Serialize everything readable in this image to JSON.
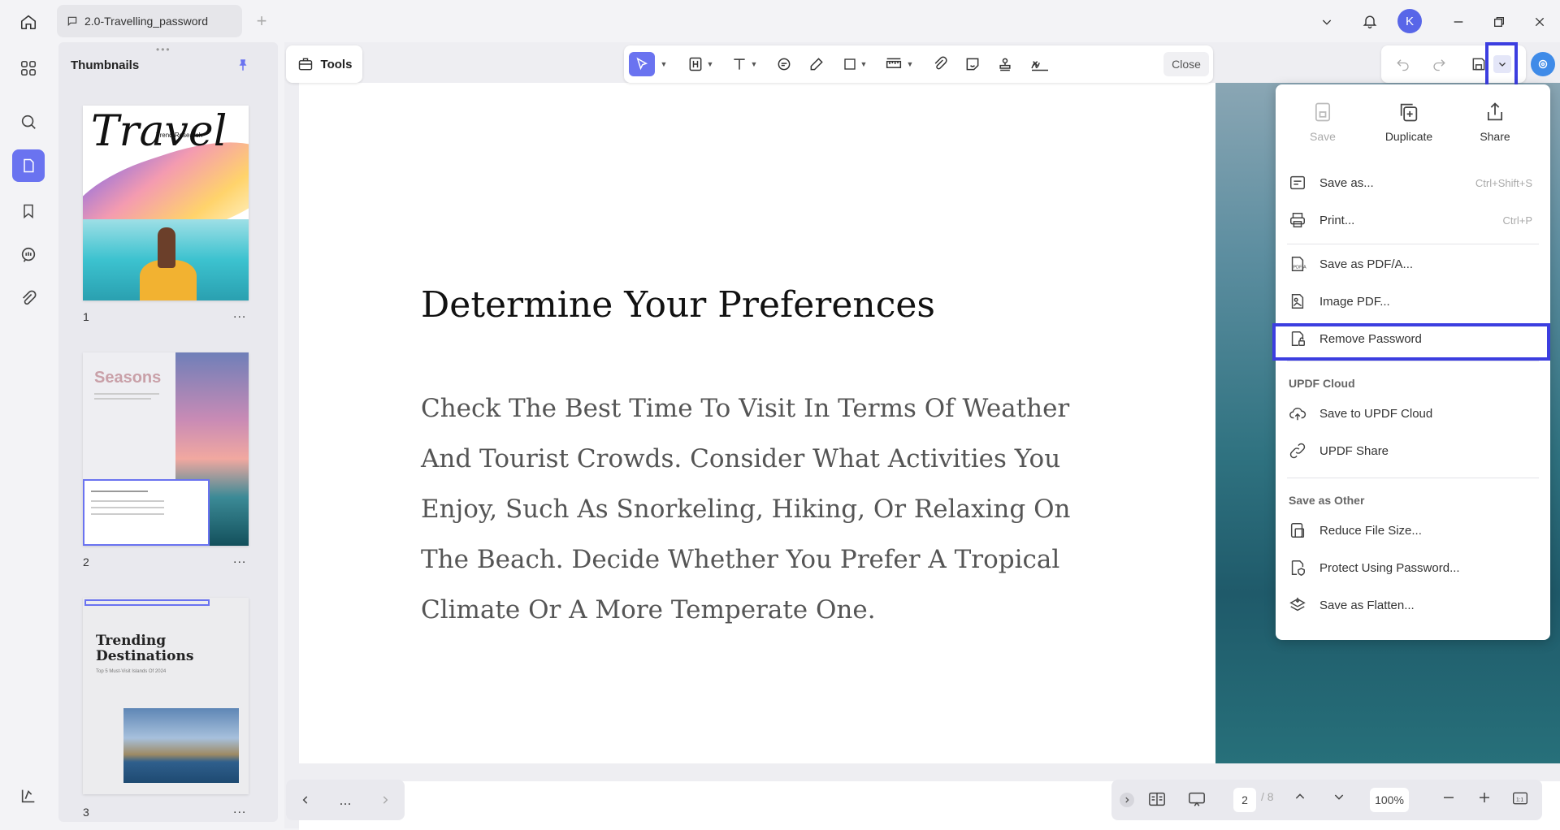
{
  "tab": {
    "title": "2.0-Travelling_password"
  },
  "user": {
    "avatar_initial": "K"
  },
  "thumbnails": {
    "title": "Thumbnails",
    "pages": [
      {
        "number": "1",
        "more": "...",
        "caption_script": "Travel",
        "caption_sub": "Trend Research"
      },
      {
        "number": "2",
        "more": "...",
        "caption_script": "Seasons"
      },
      {
        "number": "3",
        "more": "...",
        "caption_script": "Trending Destinations",
        "caption_sub": "Top 5 Must-Visit Islands Of 2024"
      }
    ]
  },
  "toolbar": {
    "tools_label": "Tools",
    "close_label": "Close"
  },
  "document": {
    "heading": "Determine Your Preferences",
    "paragraph": "Check The Best Time To Visit In Terms Of Weather And Tourist Crowds. Consider What Activities You Enjoy, Such As Snorkeling, Hiking, Or Relaxing On The Beach. Decide Whether You Prefer A Tropical Climate Or A More Temperate One."
  },
  "menu": {
    "top_actions": [
      {
        "label": "Save",
        "icon": "save-icon",
        "disabled": true
      },
      {
        "label": "Duplicate",
        "icon": "duplicate-icon"
      },
      {
        "label": "Share",
        "icon": "share-icon"
      }
    ],
    "items": [
      {
        "label": "Save as...",
        "shortcut": "Ctrl+Shift+S"
      },
      {
        "label": "Print...",
        "shortcut": "Ctrl+P"
      },
      {
        "label": "Save as PDF/A..."
      },
      {
        "label": "Image PDF..."
      },
      {
        "label": "Remove Password"
      }
    ],
    "cloud_section": "UPDF Cloud",
    "cloud_items": [
      {
        "label": "Save to UPDF Cloud"
      },
      {
        "label": "UPDF Share"
      }
    ],
    "other_section": "Save as Other",
    "other_items": [
      {
        "label": "Reduce File Size..."
      },
      {
        "label": "Protect Using Password..."
      },
      {
        "label": "Save as Flatten..."
      }
    ]
  },
  "navigation": {
    "more": "..."
  },
  "status": {
    "current_page": "2",
    "total_pages": "/ 8",
    "zoom": "100%"
  },
  "colors": {
    "accent": "#6a73f0",
    "highlight": "#3c3ee0"
  }
}
